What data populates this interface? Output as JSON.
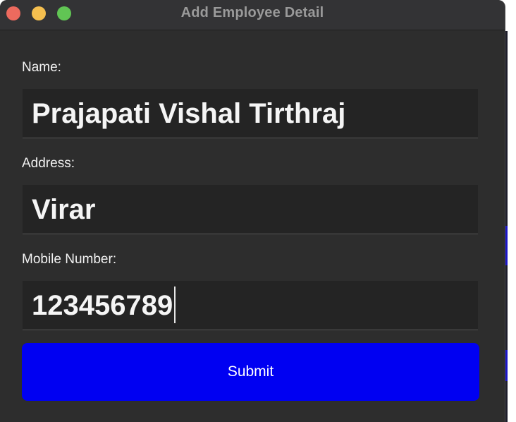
{
  "window": {
    "title": "Add Employee Detail"
  },
  "form": {
    "name_label": "Name:",
    "name_value": "Prajapati Vishal Tirthraj",
    "address_label": "Address:",
    "address_value": "Virar",
    "mobile_label": "Mobile Number:",
    "mobile_value": "123456789",
    "submit_label": "Submit"
  },
  "colors": {
    "window_bg": "#2d2d2d",
    "field_bg": "#242424",
    "submit_bg": "#0000f2",
    "close": "#ed6a5e",
    "minimize": "#f5bf4f",
    "maximize": "#61c554"
  }
}
